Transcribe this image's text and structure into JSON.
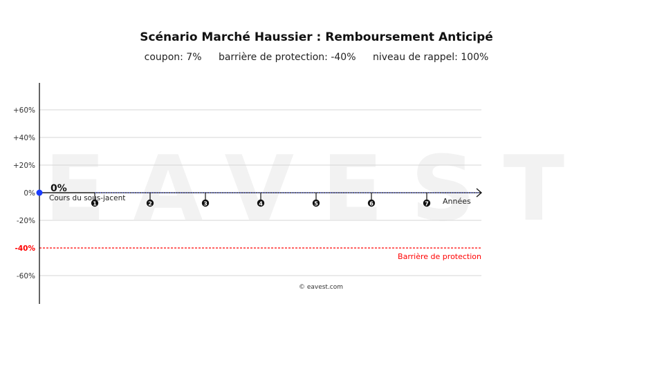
{
  "header": {
    "title": "Scénario Marché Haussier : Remboursement Anticipé",
    "params": [
      "coupon: 7%",
      "barrière de protection: -40%",
      "niveau de rappel: 100%"
    ]
  },
  "watermark": "EAVEST",
  "copyright": "© eavest.com",
  "chart_data": {
    "type": "line",
    "title": "Scénario Marché Haussier : Remboursement Anticipé",
    "xlabel": "Années",
    "ylabel": "",
    "xlim": [
      0,
      8
    ],
    "ylim": [
      -80,
      80
    ],
    "y_ticks": [
      {
        "value": 60,
        "label": "+60%"
      },
      {
        "value": 40,
        "label": "+40%"
      },
      {
        "value": 20,
        "label": "+20%"
      },
      {
        "value": 0,
        "label": "0%"
      },
      {
        "value": -20,
        "label": "-20%"
      },
      {
        "value": -40,
        "label": "-40%"
      },
      {
        "value": -60,
        "label": "-60%"
      }
    ],
    "x_markers": [
      "1",
      "2",
      "3",
      "4",
      "5",
      "6",
      "7"
    ],
    "barrier": {
      "value": -40,
      "label": "Barrière de protection",
      "color": "#ff0000"
    },
    "series": [
      {
        "name": "Cours du sous-jacent",
        "x": [
          0,
          1
        ],
        "values": [
          0,
          0
        ],
        "color": "#1a3cff"
      }
    ],
    "start_point": {
      "x": 0,
      "y": 0,
      "label": "0%",
      "color": "#1a3cff"
    },
    "reference_line_color": "#3344ee",
    "grid": true
  }
}
